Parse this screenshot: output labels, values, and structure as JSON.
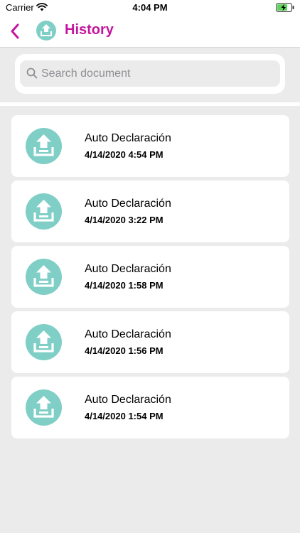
{
  "status_bar": {
    "carrier": "Carrier",
    "time": "4:04 PM",
    "wifi_icon": "wifi-icon",
    "battery_icon": "battery-charging-icon"
  },
  "nav": {
    "back_icon": "chevron-left-icon",
    "logo_icon": "upload-icon",
    "title": "History"
  },
  "search": {
    "placeholder": "Search document",
    "icon": "search-icon"
  },
  "history": {
    "items": [
      {
        "title": "Auto Declaración",
        "date": "4/14/2020 4:54 PM",
        "icon": "upload-icon"
      },
      {
        "title": "Auto Declaración",
        "date": "4/14/2020 3:22 PM",
        "icon": "upload-icon"
      },
      {
        "title": "Auto Declaración",
        "date": "4/14/2020 1:58 PM",
        "icon": "upload-icon"
      },
      {
        "title": "Auto Declaración",
        "date": "4/14/2020 1:56 PM",
        "icon": "upload-icon"
      },
      {
        "title": "Auto Declaración",
        "date": "4/14/2020 1:54 PM",
        "icon": "upload-icon"
      }
    ]
  },
  "colors": {
    "accent": "#c2179e",
    "icon_teal": "#7fcfc6",
    "background": "#ebebeb"
  }
}
